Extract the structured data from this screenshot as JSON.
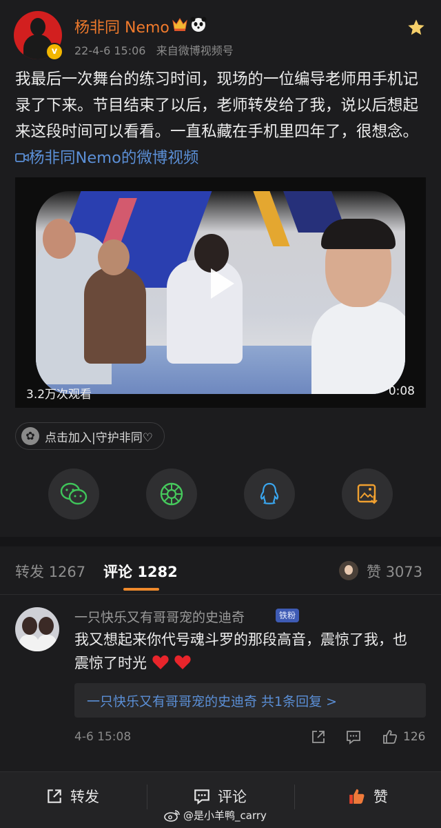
{
  "post": {
    "username": "杨非同 Nemo",
    "time": "22-4-6 15:06",
    "source_prefix": "来自",
    "source": "微博视频号",
    "verified_badge": "v",
    "text": "我最后一次舞台的练习时间，现场的一位编导老师用手机记录了下来。节目结束了以后，老师转发给了我，说以后想起来这段时间可以看看。一直私藏在手机里四年了，很想念。",
    "link_text": "杨非同Nemo的微博视频",
    "video": {
      "views": "3.2万次观看",
      "duration": "0:08"
    },
    "topic_chip": "点击加入|守护非同♡"
  },
  "share_icons": [
    "wechat-icon",
    "moments-icon",
    "qq-icon",
    "save-image-icon"
  ],
  "tabs": {
    "repost": {
      "label": "转发",
      "count": "1267"
    },
    "comment": {
      "label": "评论",
      "count": "1282"
    },
    "like": {
      "label": "赞",
      "count": "3073"
    }
  },
  "comment": {
    "name": "一只快乐又有哥哥宠的史迪奇",
    "badge": "铁粉",
    "text": "我又想起来你代号魂斗罗的那段高音，震惊了我，也震惊了时光",
    "reply_preview": "一只快乐又有哥哥宠的史迪奇  共1条回复 >",
    "time": "4-6 15:08",
    "like_count": "126"
  },
  "bottom_bar": {
    "repost_label": "转发",
    "comment_label": "评论",
    "like_label": "赞",
    "watermark": "@是小羊鸭_carry"
  },
  "colors": {
    "background": "#1c1c1e",
    "username": "#f07a2c",
    "link": "#5b8fd6",
    "tab_underline": "#f08a2c"
  }
}
